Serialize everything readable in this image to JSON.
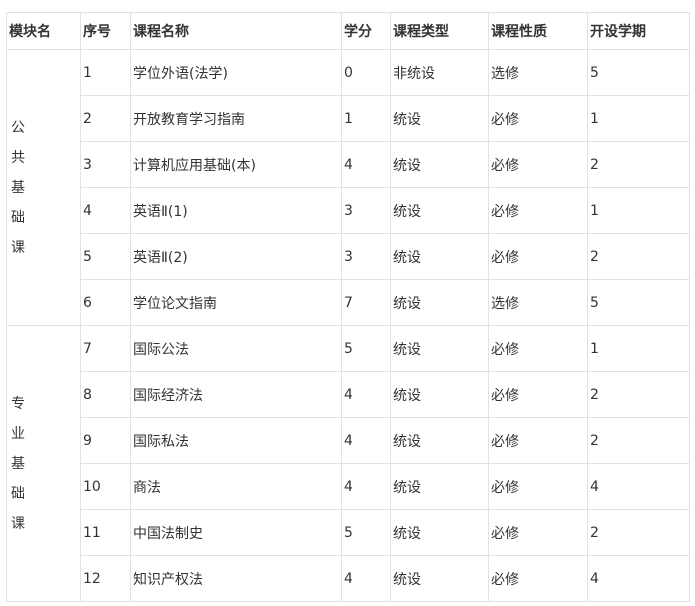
{
  "headers": [
    "模块名",
    "序号",
    "课程名称",
    "学分",
    "课程类型",
    "课程性质",
    "开设学期"
  ],
  "modules": [
    {
      "name_chars": [
        "公",
        "共",
        "基",
        "础",
        "课"
      ],
      "rows": [
        {
          "no": "1",
          "name": "学位外语(法学)",
          "credit": "0",
          "type": "非统设",
          "nature": "选修",
          "term": "5"
        },
        {
          "no": "2",
          "name": "开放教育学习指南",
          "credit": "1",
          "type": "统设",
          "nature": "必修",
          "term": "1"
        },
        {
          "no": "3",
          "name": "计算机应用基础(本)",
          "credit": "4",
          "type": "统设",
          "nature": "必修",
          "term": "2"
        },
        {
          "no": "4",
          "name": "英语Ⅱ(1)",
          "credit": "3",
          "type": "统设",
          "nature": "必修",
          "term": "1"
        },
        {
          "no": "5",
          "name": "英语Ⅱ(2)",
          "credit": "3",
          "type": "统设",
          "nature": "必修",
          "term": "2"
        },
        {
          "no": "6",
          "name": "学位论文指南",
          "credit": "7",
          "type": "统设",
          "nature": "选修",
          "term": "5"
        }
      ]
    },
    {
      "name_chars": [
        "专",
        "业",
        "基",
        "础",
        "课"
      ],
      "rows": [
        {
          "no": "7",
          "name": "国际公法",
          "credit": "5",
          "type": "统设",
          "nature": "必修",
          "term": "1"
        },
        {
          "no": "8",
          "name": "国际经济法",
          "credit": "4",
          "type": "统设",
          "nature": "必修",
          "term": "2"
        },
        {
          "no": "9",
          "name": "国际私法",
          "credit": "4",
          "type": "统设",
          "nature": "必修",
          "term": "2"
        },
        {
          "no": "10",
          "name": "商法",
          "credit": "4",
          "type": "统设",
          "nature": "必修",
          "term": "4"
        },
        {
          "no": "11",
          "name": "中国法制史",
          "credit": "5",
          "type": "统设",
          "nature": "必修",
          "term": "2"
        },
        {
          "no": "12",
          "name": "知识产权法",
          "credit": "4",
          "type": "统设",
          "nature": "必修",
          "term": "4"
        }
      ]
    }
  ]
}
